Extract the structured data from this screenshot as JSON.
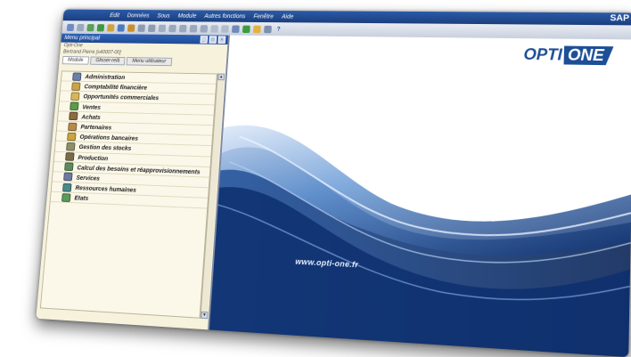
{
  "menubar": {
    "items": [
      "Edit",
      "Données",
      "Sous",
      "Module",
      "Autres fonctions",
      "Fenêtre",
      "Aide"
    ],
    "brand": "SAP"
  },
  "toolbar": {
    "icons": [
      "save-icon",
      "print-icon",
      "export-icon",
      "excel-icon",
      "home-icon",
      "refresh-icon",
      "lock-icon",
      "filter-icon",
      "sort-icon",
      "find-icon",
      "first-icon",
      "prev-icon",
      "next-icon",
      "last-icon",
      "calendar-icon",
      "settings-icon",
      "pencil-icon",
      "chart-icon",
      "alert-icon",
      "window-icon",
      "help-icon"
    ]
  },
  "panel": {
    "title": "Menu principal",
    "company": "Opti-One",
    "user": "Bertrand Pierre [s40007-00]",
    "tabs": [
      "Module",
      "Glisser-relâ",
      "Menu utilisateur"
    ],
    "modules": [
      {
        "label": "Administration",
        "color": "#6b7fa8"
      },
      {
        "label": "Comptabilité financière",
        "color": "#c9a44a"
      },
      {
        "label": "Opportunités commerciales",
        "color": "#d5b65a"
      },
      {
        "label": "Ventes",
        "color": "#5a9a4a"
      },
      {
        "label": "Achats",
        "color": "#8c6b3e"
      },
      {
        "label": "Partenaires",
        "color": "#b58a4a"
      },
      {
        "label": "Opérations bancaires",
        "color": "#c7a543"
      },
      {
        "label": "Gestion des stocks",
        "color": "#8f8f6a"
      },
      {
        "label": "Production",
        "color": "#7a6b4a"
      },
      {
        "label": "Calcul des besoins et réapprovisionnements",
        "color": "#5c8a5c"
      },
      {
        "label": "Services",
        "color": "#6a7aa0"
      },
      {
        "label": "Ressources humaines",
        "color": "#4a8a8a"
      },
      {
        "label": "Etats",
        "color": "#5a9a5a"
      }
    ]
  },
  "splash": {
    "logo_left": "OPTI",
    "logo_right": "ONE",
    "url": "www.opti-one.fr",
    "brand_color": "#1d4f96"
  }
}
